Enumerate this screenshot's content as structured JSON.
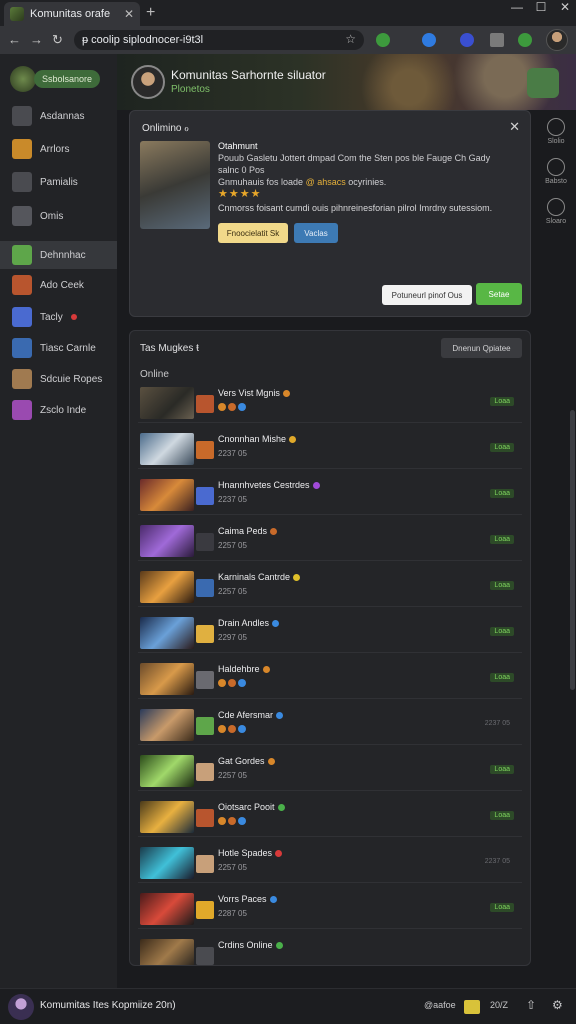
{
  "browser": {
    "tab_title": "Komunitas orafe",
    "tab_close": "✕",
    "new_tab": "+",
    "win_min": "—",
    "win_max": "☐",
    "win_close": "✕",
    "back": "←",
    "forward": "→",
    "reload": "↻",
    "url": "ᵽ coolip siplodnocer-i9t3l",
    "star": "☆",
    "ext_colors": [
      "#3d9a3d",
      "#2f7be0",
      "#3a4fd0",
      "#7a7a7a",
      "#3d9a3d"
    ]
  },
  "sidebar": {
    "header_pill": "Ssbolsanore",
    "items": [
      {
        "label": "Asdannas",
        "color": "#4a4b50"
      },
      {
        "label": "Arrlors",
        "color": "#c98a2a"
      },
      {
        "label": "Pamialis",
        "color": "#4a4b50"
      },
      {
        "label": "Omis",
        "color": "#55565c"
      },
      {
        "label": "Dehnnhac",
        "color": "#5ea64a",
        "active": true
      },
      {
        "label": "Ado Ceek",
        "color": "#b8552e"
      },
      {
        "label": "Tacly",
        "color": "#4a6ad0",
        "badge": true
      },
      {
        "label": "Tiasc Carnle",
        "color": "#3a6ab0"
      },
      {
        "label": "Sdcuie Ropes",
        "color": "#a07a50"
      },
      {
        "label": "Zsclo Inde",
        "color": "#9a4ab0"
      }
    ]
  },
  "banner": {
    "title": "Komunitas Sarhornte siluator",
    "subtitle": "Plonetos"
  },
  "rightrail": [
    {
      "label": "Slolio"
    },
    {
      "label": "Babsto"
    },
    {
      "label": "Sloaro"
    }
  ],
  "popup": {
    "header": "Onlimino",
    "header_dot": "ℴ",
    "close": "✕",
    "name": "Otahmunt",
    "line1": "Pouub Gasletu Jottert dmpad Com the Sten pos ble Fauge Ch Gady",
    "line2": "salnc 0 Pos",
    "line3_pre": "Gnmuhauis fos loade",
    "line3_hl": "@ ahsacs",
    "line3_post": "ocyrinies.",
    "stars": "★★★★",
    "desc": "Cnmorss foisant cumdi ouis pihnreinesforian pilrol Imrdny sutessiom.",
    "btn_yellow": "Fnoocielatit Sk",
    "btn_blue": "Vaclas",
    "btn_white": "Potuneurl pinof Ous",
    "btn_green": "Setae"
  },
  "panel": {
    "title": "Tas Mugkes",
    "title_suffix": "ŧ",
    "button": "Dnenun Qpiatee",
    "section": "Online",
    "rows": [
      {
        "name": "Vers Vist Mgnis",
        "sub": "",
        "status": "Loaa",
        "online": true,
        "dot": "#d8872a",
        "thumb": "linear-gradient(135deg,#5a5040,#2a2a26 60%,#6a6050)",
        "mini": "#b8552e",
        "icons": true
      },
      {
        "name": "Cnonnhan Mishe",
        "sub": "2237 05",
        "status": "Loaa",
        "online": true,
        "dot": "#e0a92a",
        "thumb": "linear-gradient(135deg,#4a6a8a,#cfd8e0 50%,#3a4a5a)",
        "mini": "#c86a2a"
      },
      {
        "name": "Hnannhvetes Cestrdes",
        "sub": "2237 05",
        "status": "Loaa",
        "online": true,
        "dot": "#a04ad8",
        "thumb": "linear-gradient(135deg,#6a2a2a,#d88a3a 50%,#3a2020)",
        "mini": "#4a6ad0"
      },
      {
        "name": "Caima Peds",
        "sub": "2257 05",
        "status": "Loaa",
        "online": true,
        "dot": "#c86a2a",
        "thumb": "linear-gradient(135deg,#4a2a6a,#a06ad8 50%,#2a1a3a)",
        "mini": "#3a3a40"
      },
      {
        "name": "Karninals Cantrde",
        "sub": "2257 05",
        "status": "Loaa",
        "online": true,
        "dot": "#e0c02a",
        "thumb": "linear-gradient(135deg,#5a3a1a,#e8a040 50%,#2a1a10)",
        "mini": "#3a6ab0"
      },
      {
        "name": "Drain Andles",
        "sub": "2297 05",
        "status": "Loaa",
        "online": true,
        "dot": "#3a8ae0",
        "thumb": "linear-gradient(135deg,#1a2a4a,#6aa0d8 50%,#2a1a1a)",
        "mini": "#e0b040"
      },
      {
        "name": "Haldehbre",
        "sub": "",
        "status": "Loaa",
        "online": true,
        "dot": "#d8872a",
        "thumb": "linear-gradient(135deg,#6a4a2a,#d89a4a 50%,#2a1a10)",
        "mini": "#6a6a70",
        "icons": true
      },
      {
        "name": "Cde Afersmar",
        "sub": "",
        "status": "2237 05",
        "online": false,
        "dot": "#3a8ae0",
        "thumb": "linear-gradient(135deg,#2a3a5a,#c89a6a 50%,#3a2a1a)",
        "mini": "#5ea64a",
        "icons": true
      },
      {
        "name": "Gat Gordes",
        "sub": "2257 05",
        "status": "Loaa",
        "online": true,
        "dot": "#d8872a",
        "thumb": "linear-gradient(135deg,#2a4a1a,#a0d86a 50%,#1a2a10)",
        "mini": "#c8a07a"
      },
      {
        "name": "Oiotsarc Pooit",
        "sub": "",
        "status": "Loaa",
        "online": true,
        "dot": "#4ab04a",
        "thumb": "linear-gradient(135deg,#4a3a1a,#e8b040 50%,#1a2a3a)",
        "mini": "#b8552e",
        "icons": true
      },
      {
        "name": "Hotle Spades",
        "sub": "2257 05",
        "status": "2237 05",
        "online": false,
        "dot": "#d83a3a",
        "thumb": "linear-gradient(135deg,#1a3a4a,#40c0d8 50%,#1a1a2a)",
        "mini": "#c8a07a"
      },
      {
        "name": "Vorrs Paces",
        "sub": "2287 05",
        "status": "Loaa",
        "online": true,
        "dot": "#3a8ae0",
        "thumb": "linear-gradient(135deg,#4a1a1a,#d84a3a 50%,#1a1a1a)",
        "mini": "#e0a92a"
      },
      {
        "name": "Crdins Online",
        "sub": "",
        "status": "",
        "online": true,
        "dot": "#4ab04a",
        "thumb": "linear-gradient(135deg,#3a2a1a,#a07a4a 50%,#1a1a1a)",
        "mini": "#4a4b50"
      }
    ]
  },
  "footer": {
    "title": "Komumitas Ites Kopmiize 20n)",
    "right1": "@aafoe",
    "right2": "20/Z",
    "right3": "⇧",
    "right4": "⚙"
  }
}
